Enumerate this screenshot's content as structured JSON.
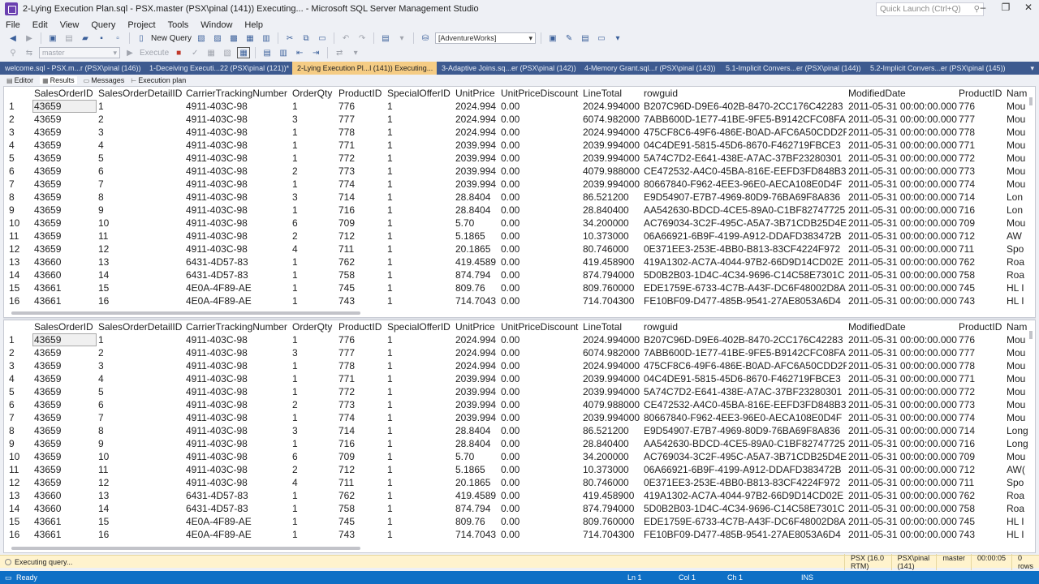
{
  "window": {
    "title": "2-Lying Execution Plan.sql - PSX.master (PSX\\pinal (141)) Executing... - Microsoft SQL Server Management Studio",
    "quick_launch_placeholder": "Quick Launch (Ctrl+Q)"
  },
  "menu": [
    "File",
    "Edit",
    "View",
    "Query",
    "Project",
    "Tools",
    "Window",
    "Help"
  ],
  "toolbar": {
    "new_query": "New Query",
    "database": "[AdventureWorks]",
    "db_context": "master",
    "execute": "Execute"
  },
  "doc_tabs": [
    {
      "label": "welcome.sql - PSX.m...r (PSX\\pinal (146))",
      "active": false
    },
    {
      "label": "1-Deceiving Executi...22 (PSX\\pinal (121))*",
      "active": false
    },
    {
      "label": "2-Lying Execution Pl...l (141)) Executing...",
      "active": true
    },
    {
      "label": "3-Adaptive Joins.sq...er (PSX\\pinal (142))",
      "active": false
    },
    {
      "label": "4-Memory Grant.sql...r (PSX\\pinal (143))",
      "active": false
    },
    {
      "label": "5.1-Implicit Convers...er (PSX\\pinal (144))",
      "active": false
    },
    {
      "label": "5.2-Implicit Convers...er (PSX\\pinal (145))",
      "active": false
    }
  ],
  "result_tabs": [
    "Editor",
    "Results",
    "Messages",
    "Execution plan"
  ],
  "columns": [
    "",
    "SalesOrderID",
    "SalesOrderDetailID",
    "CarrierTrackingNumber",
    "OrderQty",
    "ProductID",
    "SpecialOfferID",
    "UnitPrice",
    "UnitPriceDiscount",
    "LineTotal",
    "rowguid",
    "ModifiedDate",
    "ProductID",
    "Nam"
  ],
  "grid1_rows": [
    [
      "1",
      "43659",
      "1",
      "4911-403C-98",
      "1",
      "776",
      "1",
      "2024.994",
      "0.00",
      "2024.994000",
      "B207C96D-D9E6-402B-8470-2CC176C42283",
      "2011-05-31 00:00:00.000",
      "776",
      "Mou"
    ],
    [
      "2",
      "43659",
      "2",
      "4911-403C-98",
      "3",
      "777",
      "1",
      "2024.994",
      "0.00",
      "6074.982000",
      "7ABB600D-1E77-41BE-9FE5-B9142CFC08FA",
      "2011-05-31 00:00:00.000",
      "777",
      "Mou"
    ],
    [
      "3",
      "43659",
      "3",
      "4911-403C-98",
      "1",
      "778",
      "1",
      "2024.994",
      "0.00",
      "2024.994000",
      "475CF8C6-49F6-486E-B0AD-AFC6A50CDD2F",
      "2011-05-31 00:00:00.000",
      "778",
      "Mou"
    ],
    [
      "4",
      "43659",
      "4",
      "4911-403C-98",
      "1",
      "771",
      "1",
      "2039.994",
      "0.00",
      "2039.994000",
      "04C4DE91-5815-45D6-8670-F462719FBCE3",
      "2011-05-31 00:00:00.000",
      "771",
      "Mou"
    ],
    [
      "5",
      "43659",
      "5",
      "4911-403C-98",
      "1",
      "772",
      "1",
      "2039.994",
      "0.00",
      "2039.994000",
      "5A74C7D2-E641-438E-A7AC-37BF23280301",
      "2011-05-31 00:00:00.000",
      "772",
      "Mou"
    ],
    [
      "6",
      "43659",
      "6",
      "4911-403C-98",
      "2",
      "773",
      "1",
      "2039.994",
      "0.00",
      "4079.988000",
      "CE472532-A4C0-45BA-816E-EEFD3FD848B3",
      "2011-05-31 00:00:00.000",
      "773",
      "Mou"
    ],
    [
      "7",
      "43659",
      "7",
      "4911-403C-98",
      "1",
      "774",
      "1",
      "2039.994",
      "0.00",
      "2039.994000",
      "80667840-F962-4EE3-96E0-AECA108E0D4F",
      "2011-05-31 00:00:00.000",
      "774",
      "Mou"
    ],
    [
      "8",
      "43659",
      "8",
      "4911-403C-98",
      "3",
      "714",
      "1",
      "28.8404",
      "0.00",
      "86.521200",
      "E9D54907-E7B7-4969-80D9-76BA69F8A836",
      "2011-05-31 00:00:00.000",
      "714",
      "Lon"
    ],
    [
      "9",
      "43659",
      "9",
      "4911-403C-98",
      "1",
      "716",
      "1",
      "28.8404",
      "0.00",
      "28.840400",
      "AA542630-BDCD-4CE5-89A0-C1BF82747725",
      "2011-05-31 00:00:00.000",
      "716",
      "Lon"
    ],
    [
      "10",
      "43659",
      "10",
      "4911-403C-98",
      "6",
      "709",
      "1",
      "5.70",
      "0.00",
      "34.200000",
      "AC769034-3C2F-495C-A5A7-3B71CDB25D4E",
      "2011-05-31 00:00:00.000",
      "709",
      "Mou"
    ],
    [
      "11",
      "43659",
      "11",
      "4911-403C-98",
      "2",
      "712",
      "1",
      "5.1865",
      "0.00",
      "10.373000",
      "06A66921-6B9F-4199-A912-DDAFD383472B",
      "2011-05-31 00:00:00.000",
      "712",
      "AW"
    ],
    [
      "12",
      "43659",
      "12",
      "4911-403C-98",
      "4",
      "711",
      "1",
      "20.1865",
      "0.00",
      "80.746000",
      "0E371EE3-253E-4BB0-B813-83CF4224F972",
      "2011-05-31 00:00:00.000",
      "711",
      "Spo"
    ],
    [
      "13",
      "43660",
      "13",
      "6431-4D57-83",
      "1",
      "762",
      "1",
      "419.4589",
      "0.00",
      "419.458900",
      "419A1302-AC7A-4044-97B2-66D9D14CD02E",
      "2011-05-31 00:00:00.000",
      "762",
      "Roa"
    ],
    [
      "14",
      "43660",
      "14",
      "6431-4D57-83",
      "1",
      "758",
      "1",
      "874.794",
      "0.00",
      "874.794000",
      "5D0B2B03-1D4C-4C34-9696-C14C58E7301C",
      "2011-05-31 00:00:00.000",
      "758",
      "Roa"
    ],
    [
      "15",
      "43661",
      "15",
      "4E0A-4F89-AE",
      "1",
      "745",
      "1",
      "809.76",
      "0.00",
      "809.760000",
      "EDE1759E-6733-4C7B-A43F-DC6F48002D8A",
      "2011-05-31 00:00:00.000",
      "745",
      "HL I"
    ],
    [
      "16",
      "43661",
      "16",
      "4E0A-4F89-AE",
      "1",
      "743",
      "1",
      "714.7043",
      "0.00",
      "714.704300",
      "FE10BF09-D477-485B-9541-27AE8053A6D4",
      "2011-05-31 00:00:00.000",
      "743",
      "HL I"
    ]
  ],
  "grid2_rows": [
    [
      "1",
      "43659",
      "1",
      "4911-403C-98",
      "1",
      "776",
      "1",
      "2024.994",
      "0.00",
      "2024.994000",
      "B207C96D-D9E6-402B-8470-2CC176C42283",
      "2011-05-31 00:00:00.000",
      "776",
      "Mou"
    ],
    [
      "2",
      "43659",
      "2",
      "4911-403C-98",
      "3",
      "777",
      "1",
      "2024.994",
      "0.00",
      "6074.982000",
      "7ABB600D-1E77-41BE-9FE5-B9142CFC08FA",
      "2011-05-31 00:00:00.000",
      "777",
      "Mou"
    ],
    [
      "3",
      "43659",
      "3",
      "4911-403C-98",
      "1",
      "778",
      "1",
      "2024.994",
      "0.00",
      "2024.994000",
      "475CF8C6-49F6-486E-B0AD-AFC6A50CDD2F",
      "2011-05-31 00:00:00.000",
      "778",
      "Mou"
    ],
    [
      "4",
      "43659",
      "4",
      "4911-403C-98",
      "1",
      "771",
      "1",
      "2039.994",
      "0.00",
      "2039.994000",
      "04C4DE91-5815-45D6-8670-F462719FBCE3",
      "2011-05-31 00:00:00.000",
      "771",
      "Mou"
    ],
    [
      "5",
      "43659",
      "5",
      "4911-403C-98",
      "1",
      "772",
      "1",
      "2039.994",
      "0.00",
      "2039.994000",
      "5A74C7D2-E641-438E-A7AC-37BF23280301",
      "2011-05-31 00:00:00.000",
      "772",
      "Mou"
    ],
    [
      "6",
      "43659",
      "6",
      "4911-403C-98",
      "2",
      "773",
      "1",
      "2039.994",
      "0.00",
      "4079.988000",
      "CE472532-A4C0-45BA-816E-EEFD3FD848B3",
      "2011-05-31 00:00:00.000",
      "773",
      "Mou"
    ],
    [
      "7",
      "43659",
      "7",
      "4911-403C-98",
      "1",
      "774",
      "1",
      "2039.994",
      "0.00",
      "2039.994000",
      "80667840-F962-4EE3-96E0-AECA108E0D4F",
      "2011-05-31 00:00:00.000",
      "774",
      "Mou"
    ],
    [
      "8",
      "43659",
      "8",
      "4911-403C-98",
      "3",
      "714",
      "1",
      "28.8404",
      "0.00",
      "86.521200",
      "E9D54907-E7B7-4969-80D9-76BA69F8A836",
      "2011-05-31 00:00:00.000",
      "714",
      "Long"
    ],
    [
      "9",
      "43659",
      "9",
      "4911-403C-98",
      "1",
      "716",
      "1",
      "28.8404",
      "0.00",
      "28.840400",
      "AA542630-BDCD-4CE5-89A0-C1BF82747725",
      "2011-05-31 00:00:00.000",
      "716",
      "Long"
    ],
    [
      "10",
      "43659",
      "10",
      "4911-403C-98",
      "6",
      "709",
      "1",
      "5.70",
      "0.00",
      "34.200000",
      "AC769034-3C2F-495C-A5A7-3B71CDB25D4E",
      "2011-05-31 00:00:00.000",
      "709",
      "Mou"
    ],
    [
      "11",
      "43659",
      "11",
      "4911-403C-98",
      "2",
      "712",
      "1",
      "5.1865",
      "0.00",
      "10.373000",
      "06A66921-6B9F-4199-A912-DDAFD383472B",
      "2011-05-31 00:00:00.000",
      "712",
      "AW("
    ],
    [
      "12",
      "43659",
      "12",
      "4911-403C-98",
      "4",
      "711",
      "1",
      "20.1865",
      "0.00",
      "80.746000",
      "0E371EE3-253E-4BB0-B813-83CF4224F972",
      "2011-05-31 00:00:00.000",
      "711",
      "Spo"
    ],
    [
      "13",
      "43660",
      "13",
      "6431-4D57-83",
      "1",
      "762",
      "1",
      "419.4589",
      "0.00",
      "419.458900",
      "419A1302-AC7A-4044-97B2-66D9D14CD02E",
      "2011-05-31 00:00:00.000",
      "762",
      "Roa"
    ],
    [
      "14",
      "43660",
      "14",
      "6431-4D57-83",
      "1",
      "758",
      "1",
      "874.794",
      "0.00",
      "874.794000",
      "5D0B2B03-1D4C-4C34-9696-C14C58E7301C",
      "2011-05-31 00:00:00.000",
      "758",
      "Roa"
    ],
    [
      "15",
      "43661",
      "15",
      "4E0A-4F89-AE",
      "1",
      "745",
      "1",
      "809.76",
      "0.00",
      "809.760000",
      "EDE1759E-6733-4C7B-A43F-DC6F48002D8A",
      "2011-05-31 00:00:00.000",
      "745",
      "HL I"
    ],
    [
      "16",
      "43661",
      "16",
      "4E0A-4F89-AE",
      "1",
      "743",
      "1",
      "714.7043",
      "0.00",
      "714.704300",
      "FE10BF09-D477-485B-9541-27AE8053A6D4",
      "2011-05-31 00:00:00.000",
      "743",
      "HL I"
    ]
  ],
  "query_status": {
    "message": "Executing query...",
    "server": "PSX (16.0 RTM)",
    "user": "PSX\\pinal (141)",
    "database": "master",
    "elapsed": "00:00:05",
    "rows": "0 rows"
  },
  "statusbar": {
    "ready": "Ready",
    "ln": "Ln 1",
    "col": "Col 1",
    "ch": "Ch 1",
    "ins": "INS"
  },
  "colors": {
    "tabstrip": "#3d5a8f",
    "active_tab": "#f5cc84",
    "statusbar": "#0e6fc5",
    "query_status": "#fff3cd"
  }
}
